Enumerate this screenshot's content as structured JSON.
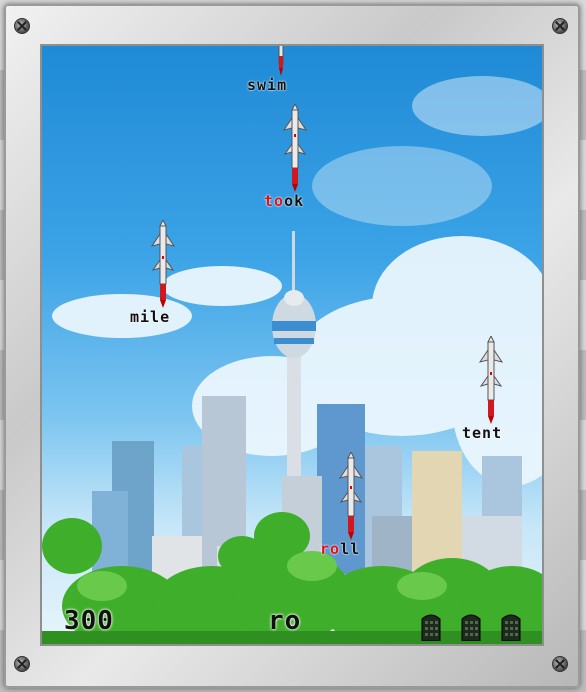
{
  "hud": {
    "score": "300",
    "input": "ro",
    "lives": 3
  },
  "missiles": [
    {
      "id": "swim",
      "typed": "",
      "rest": "swim"
    },
    {
      "id": "took",
      "typed": "to",
      "rest": "ok"
    },
    {
      "id": "mile",
      "typed": "",
      "rest": "mile"
    },
    {
      "id": "tent",
      "typed": "",
      "rest": "tent"
    },
    {
      "id": "roll",
      "typed": "ro",
      "rest": "ll"
    }
  ],
  "colors": {
    "typed": "#e0101a",
    "sky_top": "#1f8ad6",
    "tree": "#3fae2a"
  }
}
